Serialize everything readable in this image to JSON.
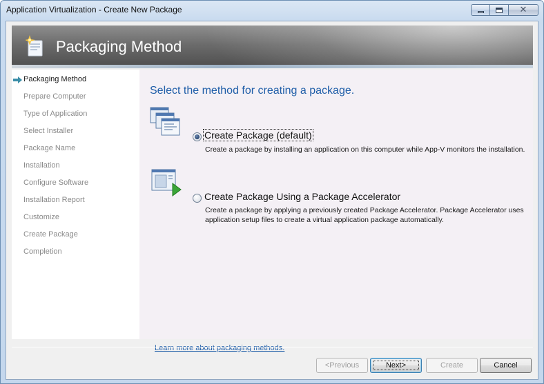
{
  "window": {
    "title": "Application Virtualization - Create New Package",
    "controls": {
      "minimize_icon": "minimize-icon",
      "maximize_icon": "maximize-icon",
      "close_icon": "close-icon"
    }
  },
  "banner": {
    "title": "Packaging Method",
    "icon": "package-sparkle-icon"
  },
  "nav": {
    "current_index": 0,
    "items": [
      {
        "label": "Packaging Method"
      },
      {
        "label": "Prepare Computer"
      },
      {
        "label": "Type of Application"
      },
      {
        "label": "Select Installer"
      },
      {
        "label": "Package Name"
      },
      {
        "label": "Installation"
      },
      {
        "label": "Configure Software"
      },
      {
        "label": "Installation Report"
      },
      {
        "label": "Customize"
      },
      {
        "label": "Create Package"
      },
      {
        "label": "Completion"
      }
    ]
  },
  "main": {
    "heading": "Select the method for creating a package.",
    "options": [
      {
        "title": "Create Package (default)",
        "description": "Create a package by installing an application on this computer while App-V monitors the installation.",
        "selected": true,
        "icon": "create-package-icon"
      },
      {
        "title": "Create Package Using a Package Accelerator",
        "description_line1": "Create a package by applying a previously created Package Accelerator. Package Accelerator uses",
        "description_line2": "application setup files to create a virtual application package automatically.",
        "selected": false,
        "icon": "package-accelerator-icon"
      }
    ],
    "learn_more": "Learn more about packaging methods."
  },
  "buttons": {
    "previous": "<Previous",
    "next": "Next>",
    "create": "Create",
    "cancel": "Cancel"
  },
  "colors": {
    "heading": "#1f5ea8",
    "link": "#1f5ea8",
    "disabled_text": "#8a8a8a"
  }
}
